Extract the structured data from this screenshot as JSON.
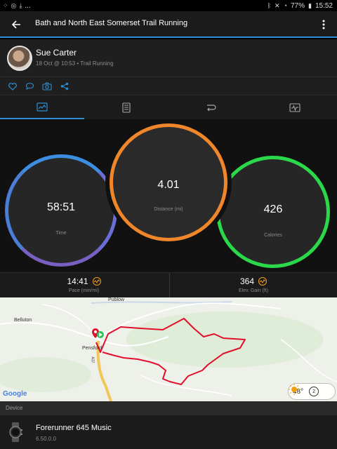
{
  "status_bar": {
    "left_icons": [
      "notification-dots-icon",
      "download-icon",
      "more-notifications-icon"
    ],
    "ellipsis": "...",
    "battery": "77%",
    "time": "15:52"
  },
  "app_bar": {
    "title": "Bath and North East Somerset Trail Running"
  },
  "profile": {
    "name": "Sue Carter",
    "subtitle": "18 Oct @ 10:53 • Trail Running"
  },
  "actions": [
    "like-icon",
    "comment-icon",
    "camera-icon",
    "share-icon"
  ],
  "tabs": [
    {
      "icon": "map-summary-icon",
      "active": true
    },
    {
      "icon": "stats-list-icon",
      "active": false
    },
    {
      "icon": "laps-icon",
      "active": false
    },
    {
      "icon": "charts-icon",
      "active": false
    }
  ],
  "stats": {
    "time": {
      "value": "58:51",
      "label": "Time"
    },
    "distance": {
      "value": "4.01",
      "label": "Distance (mi)"
    },
    "calories": {
      "value": "426",
      "label": "Calories"
    }
  },
  "metrics": {
    "pace": {
      "value": "14:41",
      "label": "Pace (min/mi)"
    },
    "elev": {
      "value": "364",
      "label": "Elev. Gain (ft)"
    }
  },
  "map": {
    "places": [
      "Publow",
      "Belluton",
      "Pensford"
    ],
    "road": "A37",
    "attribution": "Google",
    "weather": {
      "temp": "48°",
      "wind": "2"
    }
  },
  "device_section": {
    "title": "Device",
    "name": "Forerunner 645 Music",
    "version": "6.50.0.0"
  },
  "colors": {
    "accent": "#2e8fd6",
    "time_ring": "#3c8fe0",
    "distance_ring": "#f0862a",
    "calories_ring": "#2ad84a",
    "route": "#e0102c"
  }
}
